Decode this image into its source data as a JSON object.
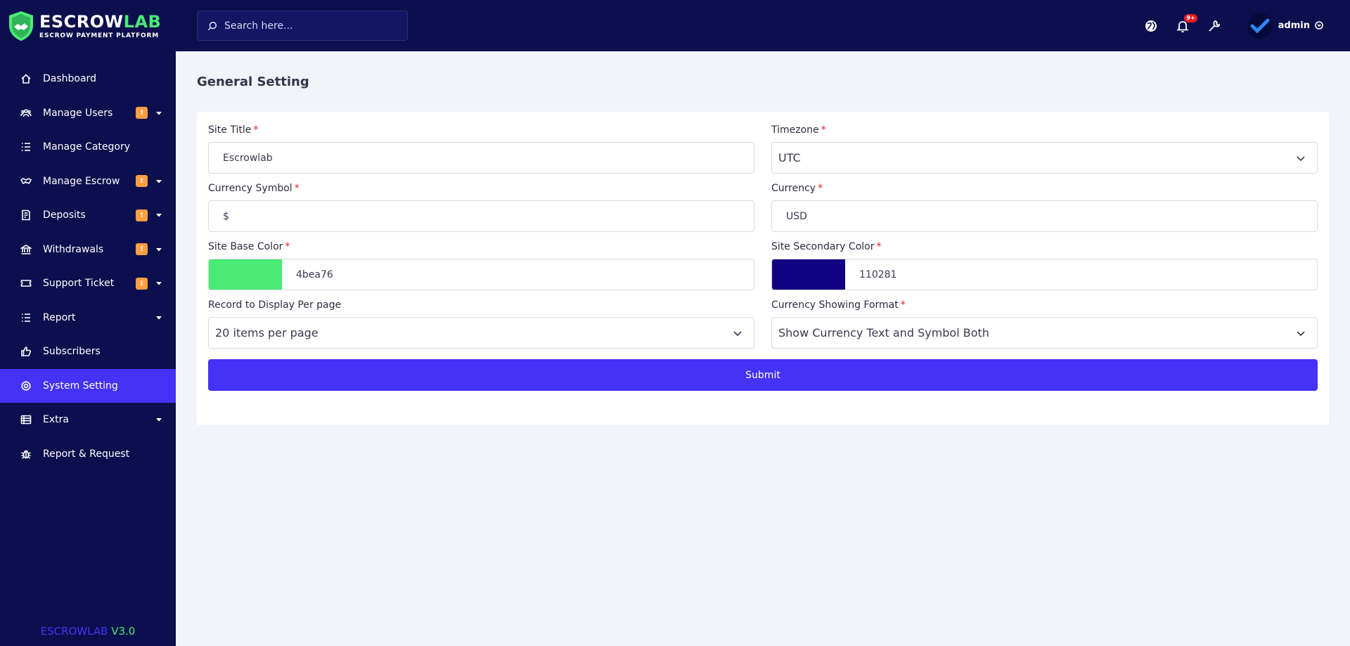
{
  "brand": {
    "name_part1": "ESCROW",
    "name_part2": "LAB",
    "tagline": "ESCROW PAYMENT PLATFORM",
    "version_part1": "ESCROWLAB",
    "version_part2": "V3.0",
    "primary_color": "#4532f7",
    "accent_color": "#4bea76",
    "navy_color": "#0b0f4d"
  },
  "sidebar": {
    "items": [
      {
        "label": "Dashboard",
        "icon": "home-icon",
        "badge": "",
        "chevron": false,
        "active": false
      },
      {
        "label": "Manage Users",
        "icon": "users-icon",
        "badge": "!",
        "chevron": true,
        "active": false
      },
      {
        "label": "Manage Category",
        "icon": "list-icon",
        "badge": "",
        "chevron": false,
        "active": false
      },
      {
        "label": "Manage Escrow",
        "icon": "handshake-icon",
        "badge": "!",
        "chevron": true,
        "active": false
      },
      {
        "label": "Deposits",
        "icon": "receipt-icon",
        "badge": "!",
        "chevron": true,
        "active": false
      },
      {
        "label": "Withdrawals",
        "icon": "bank-icon",
        "badge": "!",
        "chevron": true,
        "active": false
      },
      {
        "label": "Support Ticket",
        "icon": "ticket-icon",
        "badge": "!",
        "chevron": true,
        "active": false
      },
      {
        "label": "Report",
        "icon": "list-icon",
        "badge": "",
        "chevron": true,
        "active": false
      },
      {
        "label": "Subscribers",
        "icon": "thumbs-up-icon",
        "badge": "",
        "chevron": false,
        "active": false
      },
      {
        "label": "System Setting",
        "icon": "settings-icon",
        "badge": "",
        "chevron": false,
        "active": true
      },
      {
        "label": "Extra",
        "icon": "table-icon",
        "badge": "",
        "chevron": true,
        "active": false
      },
      {
        "label": "Report & Request",
        "icon": "bug-icon",
        "badge": "",
        "chevron": false,
        "active": false
      }
    ]
  },
  "topbar": {
    "search_placeholder": "Search here...",
    "notification_count": "9+",
    "admin_name": "admin"
  },
  "page": {
    "title": "General Setting",
    "fields": {
      "site_title": {
        "label": "Site Title",
        "value": "Escrowlab"
      },
      "timezone": {
        "label": "Timezone",
        "value": "UTC"
      },
      "currency_symbol": {
        "label": "Currency Symbol",
        "value": "$"
      },
      "currency": {
        "label": "Currency",
        "value": "USD"
      },
      "base_color": {
        "label": "Site Base Color",
        "value": "4bea76",
        "swatch": "#4bea76"
      },
      "secondary_color": {
        "label": "Site Secondary Color",
        "value": "110281",
        "swatch": "#110281"
      },
      "per_page": {
        "label": "Record to Display Per page",
        "value": "20 items per page"
      },
      "currency_format": {
        "label": "Currency Showing Format",
        "value": "Show Currency Text and Symbol Both"
      }
    },
    "submit_label": "Submit"
  }
}
